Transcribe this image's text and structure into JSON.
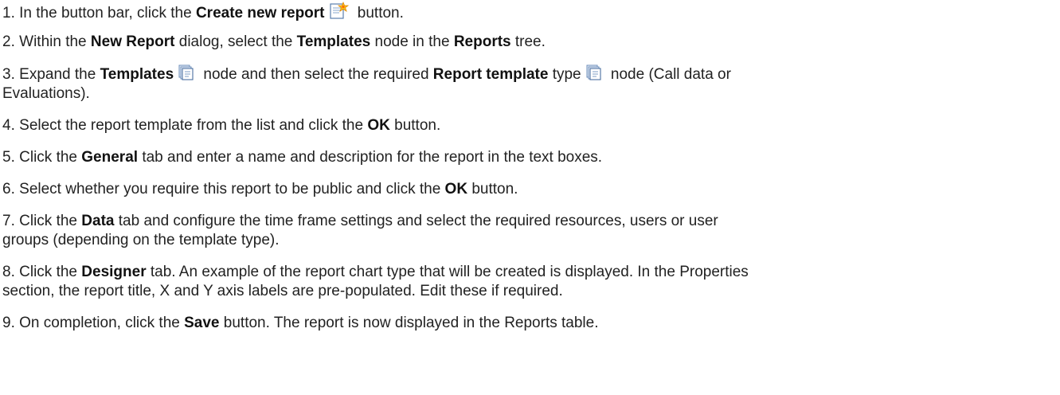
{
  "steps": [
    {
      "num": "1.",
      "t1": "In the button bar, click the ",
      "b1": "Create new report",
      "icon": "create-new-report-icon",
      "t2": " button."
    },
    {
      "num": "2.",
      "t1": "Within the ",
      "b1": "New Report",
      "t2": " dialog, select the ",
      "b2": "Templates",
      "t3": " node in the ",
      "b3": "Reports",
      "t4": " tree."
    },
    {
      "num": "3.",
      "t1": "Expand the ",
      "b1": "Templates",
      "icon1": "templates-folder-icon",
      "t2": " node and then select the required ",
      "b2": "Report template",
      "t3": " type",
      "icon2": "report-template-icon",
      "t4": " node (Call data or",
      "line2": "Evaluations)."
    },
    {
      "num": "4.",
      "t1": "Select the report template from the list and click the ",
      "b1": "OK",
      "t2": " button."
    },
    {
      "num": "5.",
      "t1": "Click the ",
      "b1": "General",
      "t2": " tab and enter a name and description for the report in the text boxes."
    },
    {
      "num": "6.",
      "t1": "Select whether you require this report to be public and click the ",
      "b1": "OK",
      "t2": " button."
    },
    {
      "num": "7.",
      "t1": "Click the ",
      "b1": "Data",
      "t2": " tab and configure the time frame settings and select the required resources, users or user",
      "line2": "groups (depending on the template type)."
    },
    {
      "num": "8.",
      "t1": "Click the ",
      "b1": "Designer",
      "t2": " tab. An example of the report chart type that will be created is displayed. In the Properties",
      "line2": "section, the report title, X and Y axis labels are pre-populated. Edit these if required."
    },
    {
      "num": "9.",
      "t1": "On completion, click the ",
      "b1": "Save",
      "t2": " button. The report is now displayed in the Reports table."
    }
  ]
}
